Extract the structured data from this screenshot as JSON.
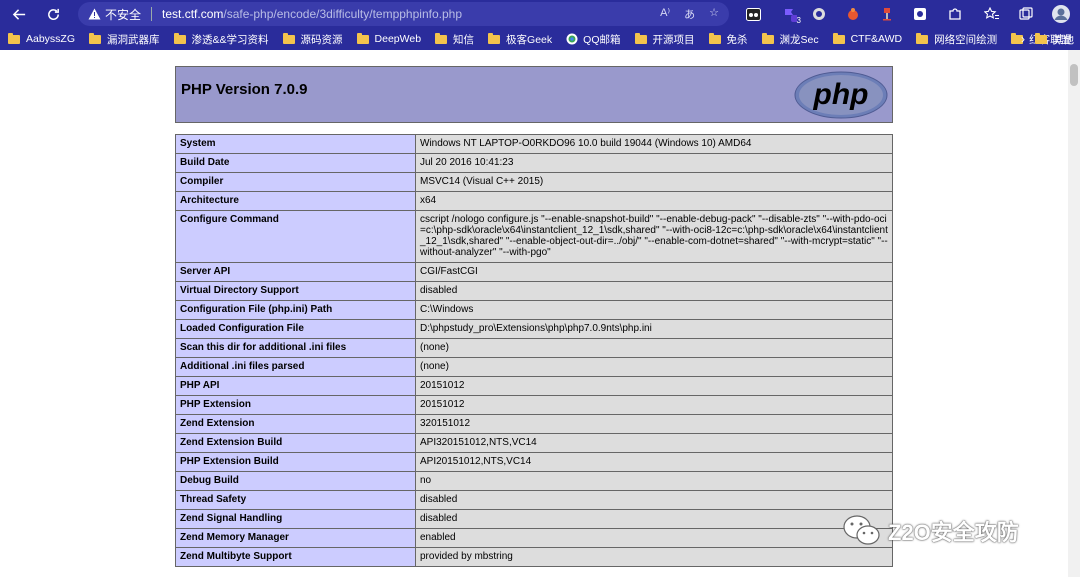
{
  "browser": {
    "security_label": "不安全",
    "url_host": "test.ctf.com",
    "url_path": "/safe-php/encode/3difficulty/tempphpinfo.php",
    "ext_badge": "3"
  },
  "bookmarks": [
    "AabyssZG",
    "漏洞武器库",
    "渗透&&学习资料",
    "源码资源",
    "DeepWeb",
    "知信",
    "极客Geek",
    "QQ邮箱",
    "开源项目",
    "免杀",
    "渊龙Sec",
    "CTF&AWD",
    "网络空间绘测",
    "红客联盟",
    "其他"
  ],
  "php": {
    "title": "PHP Version 7.0.9",
    "logo_text": "php"
  },
  "info_rows": [
    {
      "key": "System",
      "value": "Windows NT LAPTOP-O0RKDO96 10.0 build 19044 (Windows 10) AMD64"
    },
    {
      "key": "Build Date",
      "value": "Jul 20 2016 10:41:23"
    },
    {
      "key": "Compiler",
      "value": "MSVC14 (Visual C++ 2015)"
    },
    {
      "key": "Architecture",
      "value": "x64"
    },
    {
      "key": "Configure Command",
      "value": "cscript /nologo configure.js \"--enable-snapshot-build\" \"--enable-debug-pack\" \"--disable-zts\" \"--with-pdo-oci=c:\\php-sdk\\oracle\\x64\\instantclient_12_1\\sdk,shared\" \"--with-oci8-12c=c:\\php-sdk\\oracle\\x64\\instantclient_12_1\\sdk,shared\" \"--enable-object-out-dir=../obj/\" \"--enable-com-dotnet=shared\" \"--with-mcrypt=static\" \"--without-analyzer\" \"--with-pgo\""
    },
    {
      "key": "Server API",
      "value": "CGI/FastCGI"
    },
    {
      "key": "Virtual Directory Support",
      "value": "disabled"
    },
    {
      "key": "Configuration File (php.ini) Path",
      "value": "C:\\Windows"
    },
    {
      "key": "Loaded Configuration File",
      "value": "D:\\phpstudy_pro\\Extensions\\php\\php7.0.9nts\\php.ini"
    },
    {
      "key": "Scan this dir for additional .ini files",
      "value": "(none)"
    },
    {
      "key": "Additional .ini files parsed",
      "value": "(none)"
    },
    {
      "key": "PHP API",
      "value": "20151012"
    },
    {
      "key": "PHP Extension",
      "value": "20151012"
    },
    {
      "key": "Zend Extension",
      "value": "320151012"
    },
    {
      "key": "Zend Extension Build",
      "value": "API320151012,NTS,VC14"
    },
    {
      "key": "PHP Extension Build",
      "value": "API20151012,NTS,VC14"
    },
    {
      "key": "Debug Build",
      "value": "no"
    },
    {
      "key": "Thread Safety",
      "value": "disabled"
    },
    {
      "key": "Zend Signal Handling",
      "value": "disabled"
    },
    {
      "key": "Zend Memory Manager",
      "value": "enabled"
    },
    {
      "key": "Zend Multibyte Support",
      "value": "provided by mbstring"
    }
  ],
  "watermark": "Z2O安全攻防"
}
